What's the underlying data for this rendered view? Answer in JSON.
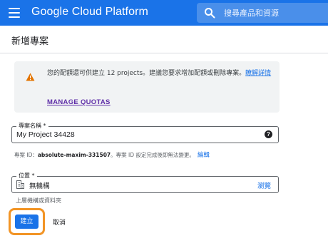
{
  "header": {
    "brand": "Google Cloud Platform",
    "search_placeholder": "搜尋產品和資源",
    "bar_color": "#1a73e8"
  },
  "page": {
    "title": "新增專案"
  },
  "quota_notice": {
    "message": "您的配額還可供建立 12 projects。建議您要求增加配額或刪除專案。",
    "link_text": "瞭解詳情",
    "manage_label": "MANAGE QUOTAS",
    "icon": "warning-icon",
    "icon_color": "#e37400"
  },
  "project_name": {
    "label": "專案名稱 *",
    "value": "My Project 34428",
    "help_icon": "?"
  },
  "project_id": {
    "prefix": "專案 ID：",
    "value": "absolute-maxim-331507",
    "note": "。專案 ID 設定完成後即無法變更。",
    "edit_label": "編輯"
  },
  "location": {
    "label": "位置 *",
    "value": "無機構",
    "browse_label": "瀏覽",
    "helper": "上層機構或資料夾",
    "icon": "organization-icon"
  },
  "actions": {
    "create_label": "建立",
    "cancel_label": "取消",
    "primary_color": "#1a73e8",
    "highlight_color": "#f29425"
  }
}
